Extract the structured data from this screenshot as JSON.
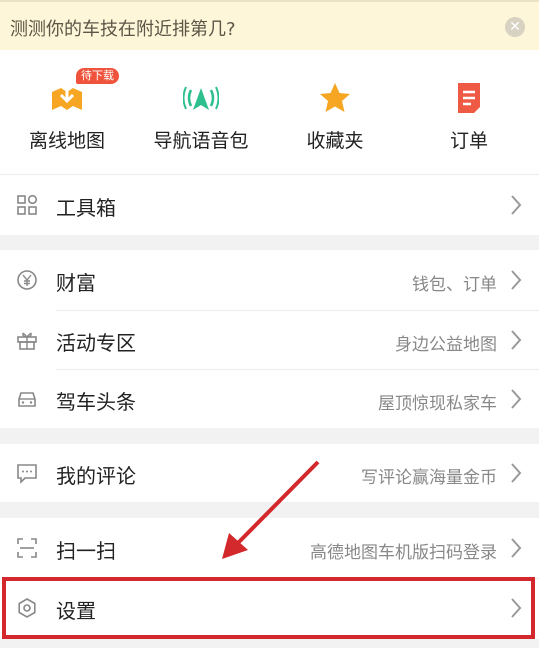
{
  "banner": {
    "text": "测测你的车技在附近排第几?",
    "close_icon": "close-icon"
  },
  "shortcuts": [
    {
      "label": "离线地图",
      "icon": "offline-map-icon",
      "badge": "待下载"
    },
    {
      "label": "导航语音包",
      "icon": "voice-pack-icon"
    },
    {
      "label": "收藏夹",
      "icon": "star-icon"
    },
    {
      "label": "订单",
      "icon": "order-icon"
    }
  ],
  "menu": {
    "toolbox": {
      "title": "工具箱",
      "icon": "toolbox-icon"
    },
    "wealth": {
      "title": "财富",
      "detail": "钱包、订单",
      "icon": "yen-icon"
    },
    "activity": {
      "title": "活动专区",
      "detail": "身边公益地图",
      "icon": "gift-icon"
    },
    "news": {
      "title": "驾车头条",
      "detail": "屋顶惊现私家车",
      "icon": "car-icon"
    },
    "reviews": {
      "title": "我的评论",
      "detail": "写评论赢海量金币",
      "icon": "comment-icon"
    },
    "scan": {
      "title": "扫一扫",
      "detail": "高德地图车机版扫码登录",
      "icon": "scan-icon"
    },
    "settings": {
      "title": "设置",
      "icon": "settings-icon"
    }
  },
  "colors": {
    "accent_orange": "#f6a623",
    "accent_green": "#2dbf8e",
    "highlight_red": "#d3292d",
    "order_red": "#ef5a45"
  }
}
